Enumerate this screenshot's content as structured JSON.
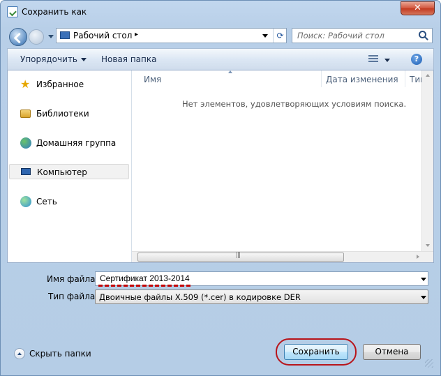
{
  "window": {
    "title": "Сохранить как",
    "close_label": "✕"
  },
  "address": {
    "location": "Рабочий стол",
    "chevron": "▸",
    "refresh": "⟳"
  },
  "search": {
    "placeholder": "Поиск: Рабочий стол"
  },
  "toolbar": {
    "organize_label": "Упорядочить",
    "new_folder_label": "Новая папка",
    "help_label": "?"
  },
  "navigation": {
    "items": [
      {
        "label": "Избранное",
        "icon": "star-icon"
      },
      {
        "label": "Библиотеки",
        "icon": "libraries-icon"
      },
      {
        "label": "Домашняя группа",
        "icon": "homegroup-icon"
      },
      {
        "label": "Компьютер",
        "icon": "computer-icon",
        "selected": true
      },
      {
        "label": "Сеть",
        "icon": "network-icon"
      }
    ]
  },
  "file_list": {
    "columns": [
      "Имя",
      "Дата изменения",
      "Тип"
    ],
    "empty_message": "Нет элементов, удовлетворяющих условиям поиска."
  },
  "form": {
    "filename_label": "Имя файла:",
    "filename_value": "Сертификат 2013-2014",
    "filetype_label": "Тип файла:",
    "filetype_value": "Двоичные файлы X.509 (*.cer) в кодировке DER"
  },
  "footer": {
    "hide_folders_label": "Скрыть папки",
    "save_label": "Сохранить",
    "cancel_label": "Отмена"
  },
  "colors": {
    "annotation": "#b8141a",
    "window_frame": "#b5cde6"
  }
}
